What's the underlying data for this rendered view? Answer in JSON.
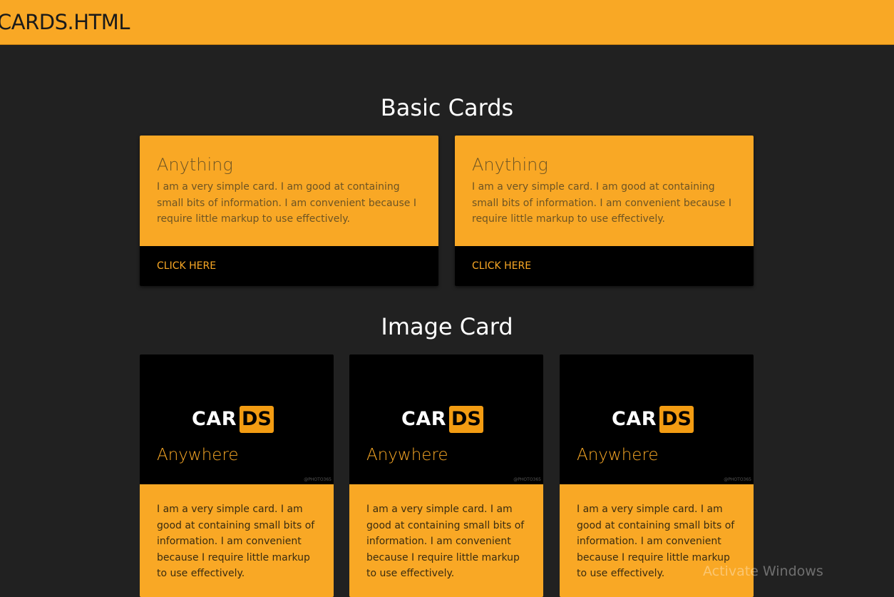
{
  "header": {
    "brand": "CARDS.HTML"
  },
  "basic_section": {
    "title": "Basic Cards",
    "cards": [
      {
        "title": "Anything",
        "text": "I am a very simple card. I am good at containing small bits of information. I am convenient because I require little markup to use effectively.",
        "action": "CLICK HERE"
      },
      {
        "title": "Anything",
        "text": "I am a very simple card. I am good at containing small bits of information. I am convenient because I require little markup to use effectively.",
        "action": "CLICK HERE"
      }
    ]
  },
  "image_section": {
    "title": "Image Card",
    "cards": [
      {
        "logo_main": "CAR",
        "logo_badge": "DS",
        "title": "Anywhere",
        "watermark": "@PHOTO365",
        "text": "I am a very simple card. I am good at containing small bits of information. I am convenient because I require little markup to use effectively."
      },
      {
        "logo_main": "CAR",
        "logo_badge": "DS",
        "title": "Anywhere",
        "watermark": "@PHOTO365",
        "text": "I am a very simple card. I am good at containing small bits of information. I am convenient because I require little markup to use effectively."
      },
      {
        "logo_main": "CAR",
        "logo_badge": "DS",
        "title": "Anywhere",
        "watermark": "@PHOTO365",
        "text": "I am a very simple card. I am good at containing small bits of information. I am convenient because I require little markup to use effectively."
      }
    ]
  },
  "overlay": {
    "activate_windows": "Activate Windows"
  },
  "colors": {
    "accent": "#f9a825",
    "background": "#212121",
    "card_action_bg": "#000000"
  }
}
